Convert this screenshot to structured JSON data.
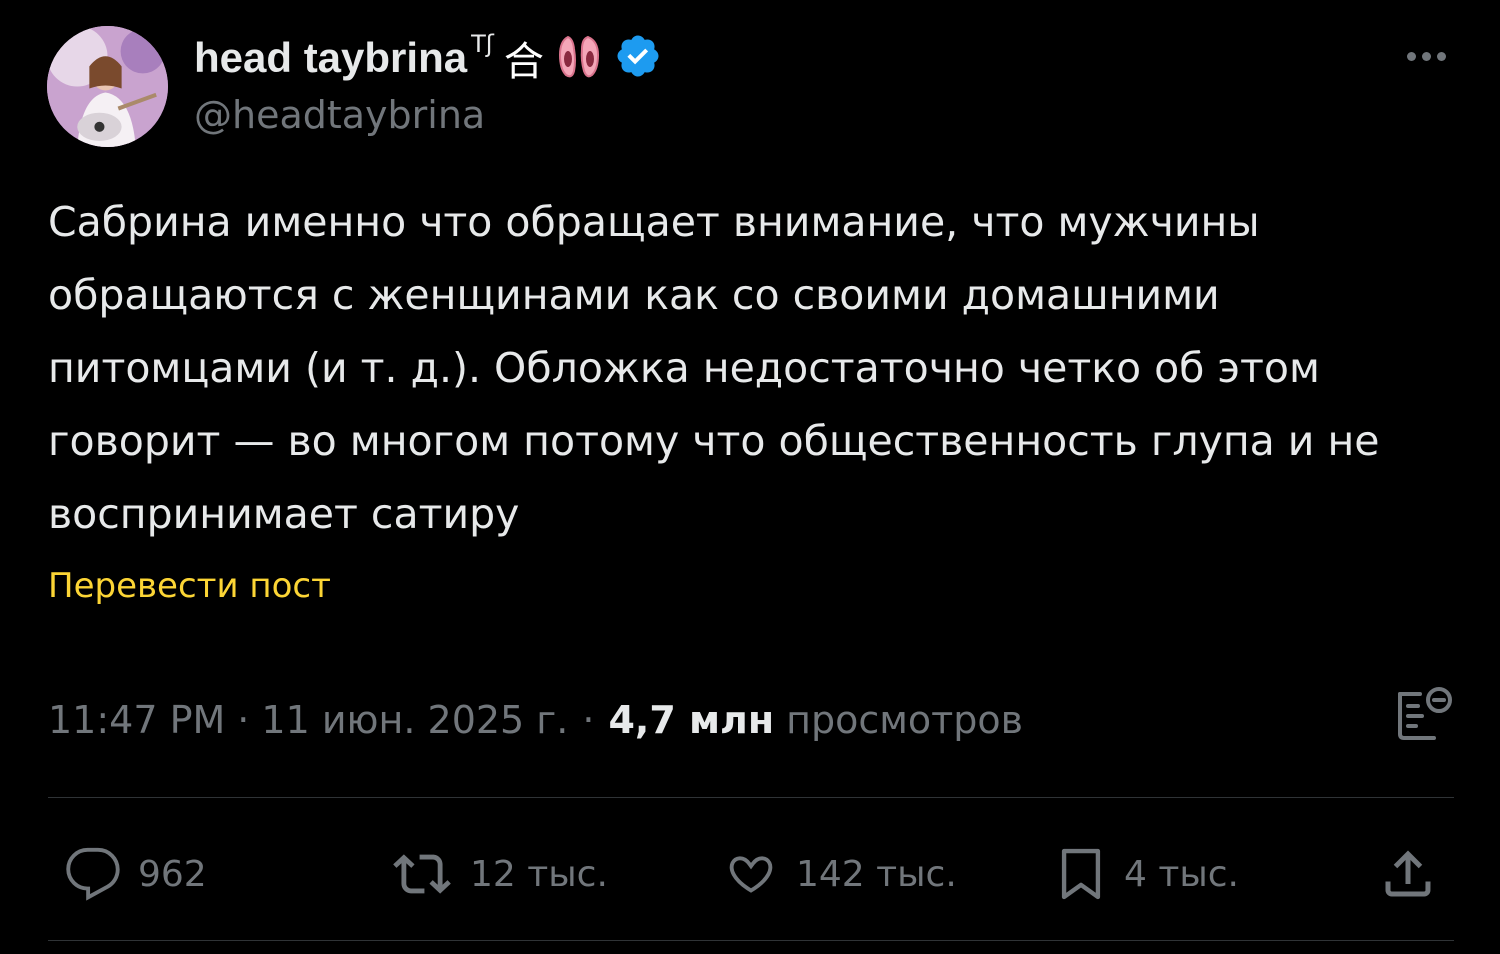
{
  "author": {
    "display_name": "head taybrina",
    "name_superscript": "Tʃ",
    "name_glyph": "合",
    "handle": "@headtaybrina",
    "verified": true,
    "verified_color": "#1d9bf0",
    "emoji_icon": "ballet-shoes-icon"
  },
  "post": {
    "text": "Сабрина именно что обращает внимание, что мужчины\nобращаются с женщинами как со своими домашними\nпитомцами (и т. д.). Обложка недостаточно четко об этом\nговорит — во многом потому что общественность глупа и не\nвоспринимает сатиру",
    "translate_label": "Перевести пост",
    "translate_color": "#fcd535"
  },
  "meta": {
    "time": "11:47 PM",
    "separator": "·",
    "date": "11 июн. 2025 г.",
    "views_count": "4,7 млн",
    "views_label": "просмотров"
  },
  "actions": {
    "replies": "962",
    "reposts": "12 тыс.",
    "likes": "142 тыс.",
    "bookmarks": "4 тыс."
  }
}
